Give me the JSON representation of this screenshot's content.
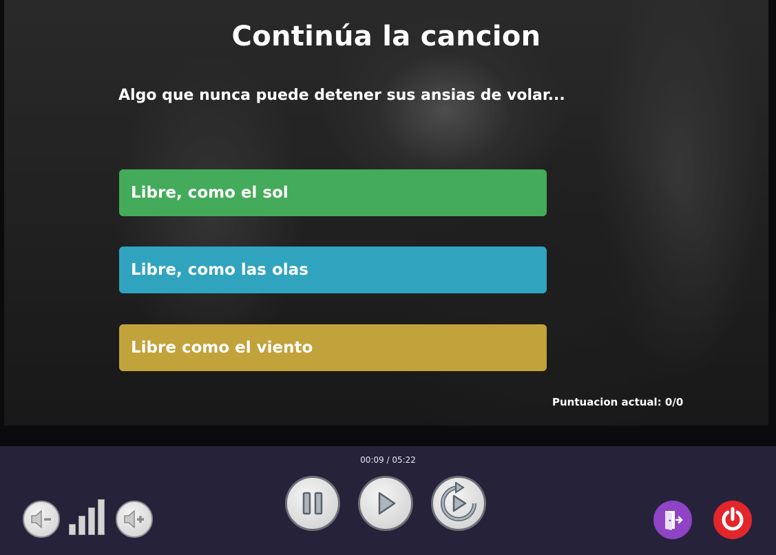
{
  "quiz": {
    "title": "Continúa la cancion",
    "question": "Algo que nunca puede detener sus ansias de volar...",
    "answers": [
      {
        "label": "Libre, como el sol",
        "color": "#43ab59"
      },
      {
        "label": "Libre, como las olas",
        "color": "#30a4be"
      },
      {
        "label": "Libre  como el viento",
        "color": "#c2a23b"
      }
    ],
    "score": "Puntuacion actual: 0/0"
  },
  "player": {
    "time": "00:09 / 05:22",
    "controls": {
      "pause_icon": "pause-icon",
      "play_icon": "play-icon",
      "replay_icon": "replay-icon"
    },
    "volume": {
      "down_icon": "volume-down-icon",
      "up_icon": "volume-up-icon",
      "level_icon": "volume-level-icon",
      "level": 3,
      "max": 4
    },
    "exit_icon": "exit-door-icon",
    "power_icon": "power-icon",
    "colors": {
      "exit": "#8e44c4",
      "power": "#e2262b",
      "bar": "#25223a"
    }
  }
}
